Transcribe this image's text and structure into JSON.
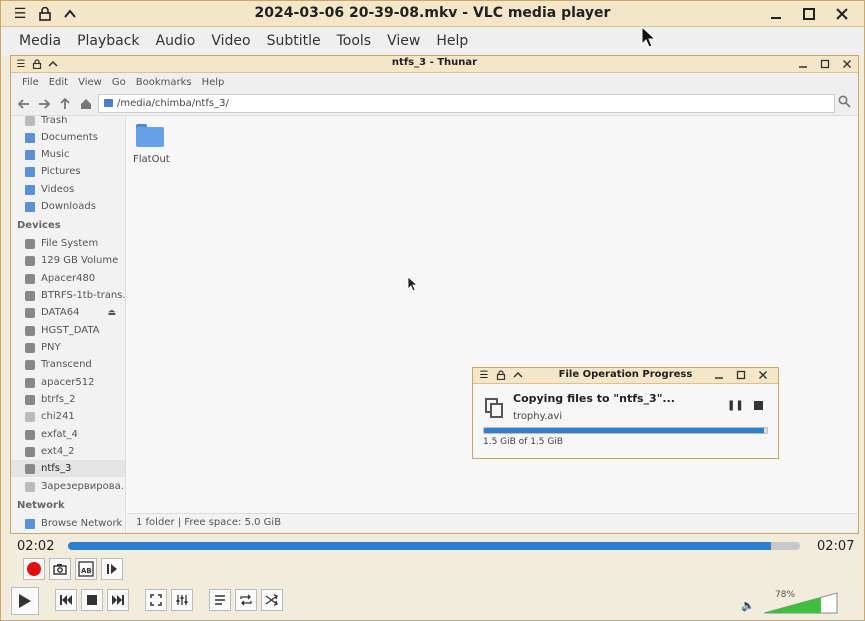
{
  "vlc": {
    "title": "2024-03-06 20-39-08.mkv - VLC media player",
    "menu": [
      "Media",
      "Playback",
      "Audio",
      "Video",
      "Subtitle",
      "Tools",
      "View",
      "Help"
    ],
    "time_elapsed": "02:02",
    "time_total": "02:07",
    "seek_fraction": 0.96,
    "volume": "78%",
    "volume_fraction": 0.78
  },
  "thunar": {
    "title": "ntfs_3 - Thunar",
    "menu": [
      "File",
      "Edit",
      "View",
      "Go",
      "Bookmarks",
      "Help"
    ],
    "path": "/media/chimba/ntfs_3/",
    "places": [
      "Trash",
      "Documents",
      "Music",
      "Pictures",
      "Videos",
      "Downloads"
    ],
    "devices_heading": "Devices",
    "devices": [
      "File System",
      "129 GB Volume",
      "Apacer480",
      "BTRFS-1tb-trans...",
      "DATA64",
      "HGST_DATA",
      "PNY",
      "Transcend",
      "apacer512",
      "btrfs_2",
      "chi241",
      "exfat_4",
      "ext4_2",
      "ntfs_3",
      "Зарезервирова..."
    ],
    "network_heading": "Network",
    "network": [
      "Browse Network"
    ],
    "folder_name": "FlatOut",
    "status": "1 folder  |  Free space: 5.0 GiB"
  },
  "file_op": {
    "title": "File Operation Progress",
    "heading": "Copying files to \"ntfs_3\"...",
    "file": "trophy.avi",
    "progress_fraction": 0.99,
    "size_text": "1.5 GiB of 1.5 GiB"
  },
  "colors": {
    "accent": "#2f7fd0",
    "titlebar": "#f4e6c8",
    "record": "#e01010"
  }
}
